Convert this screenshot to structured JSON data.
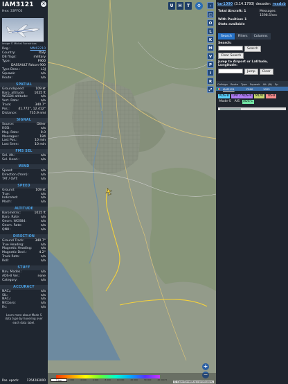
{
  "aircraft": {
    "callsign": "IAM3121",
    "hex": "Hex: 33FFC6",
    "photo_credit": "Image © Michal Furnatrizas"
  },
  "info_rows": [
    {
      "k": "Reg.:",
      "v": "MM62210",
      "link": true
    },
    {
      "k": "Country:",
      "v": "Italy"
    },
    {
      "k": "DB flags:",
      "v": "military"
    },
    {
      "k": "Type:",
      "v": "F900"
    },
    {
      "k": "",
      "v": "DASSAULT Falcon 900"
    },
    {
      "k": "Type Desc.:",
      "v": "L3J"
    },
    {
      "k": "Squawk:",
      "v": "n/a"
    },
    {
      "k": "Route:",
      "v": "n/a"
    }
  ],
  "sections": {
    "spatial": {
      "title": "SPATIAL",
      "rows": [
        {
          "k": "Groundspeed:",
          "v": "109 kt"
        },
        {
          "k": "Baro. altitude:",
          "v": "1025 ft"
        },
        {
          "k": "WGS84 altitude:",
          "v": "n/a"
        },
        {
          "k": "Vert. Rate:",
          "v": "n/a"
        },
        {
          "k": "Track:",
          "v": "340.7°"
        },
        {
          "k": "Pos.:",
          "v": "41.772°, 12.412°"
        },
        {
          "k": "Distance:",
          "v": "735.9 nmi"
        }
      ]
    },
    "signal": {
      "title": "SIGNAL",
      "rows": [
        {
          "k": "Source:",
          "v": "Other"
        },
        {
          "k": "RSSI:",
          "v": "n/a"
        },
        {
          "k": "Msg. Rate:",
          "v": "0.0"
        },
        {
          "k": "Messages:",
          "v": "184"
        },
        {
          "k": "Last Pos.:",
          "v": "10 min"
        },
        {
          "k": "Last Seen:",
          "v": "10 min"
        }
      ]
    },
    "fms": {
      "title": "FMS SEL",
      "rows": [
        {
          "k": "Sel. Alt.:",
          "v": "n/a"
        },
        {
          "k": "Sel. Head.:",
          "v": "n/a"
        }
      ]
    },
    "wind": {
      "title": "WIND",
      "rows": [
        {
          "k": "Speed:",
          "v": "n/a"
        },
        {
          "k": "Direction (from):",
          "v": "n/a"
        },
        {
          "k": "TAT / OAT:",
          "v": "n/a"
        }
      ]
    },
    "speed": {
      "title": "SPEED",
      "rows": [
        {
          "k": "Ground:",
          "v": "109 kt"
        },
        {
          "k": "True:",
          "v": "n/a"
        },
        {
          "k": "Indicated:",
          "v": "n/a"
        },
        {
          "k": "Mach:",
          "v": "n/a"
        }
      ]
    },
    "altitude": {
      "title": "ALTITUDE",
      "rows": [
        {
          "k": "Barometric:",
          "v": "1025 ft"
        },
        {
          "k": "Baro. Rate:",
          "v": "n/a"
        },
        {
          "k": "Geom. WGS84:",
          "v": "n/a"
        },
        {
          "k": "Geom. Rate:",
          "v": "n/a"
        },
        {
          "k": "QNH:",
          "v": "n/a"
        }
      ]
    },
    "direction": {
      "title": "DIRECTION",
      "rows": [
        {
          "k": "Ground Track:",
          "v": "340.7°"
        },
        {
          "k": "True Heading:",
          "v": "n/a"
        },
        {
          "k": "Magnetic Heading:",
          "v": "n/a"
        },
        {
          "k": "Magnetic Decl.:",
          "v": "4.2°"
        },
        {
          "k": "Track Rate:",
          "v": "n/a"
        },
        {
          "k": "Roll:",
          "v": "n/a"
        }
      ]
    },
    "stuff": {
      "title": "STUFF",
      "rows": [
        {
          "k": "Nav. Modes:",
          "v": "n/a"
        },
        {
          "k": "ADS-B Ver.:",
          "v": "none"
        },
        {
          "k": "Category:",
          "v": "n/a"
        }
      ]
    },
    "accuracy": {
      "title": "ACCURACY",
      "rows": [
        {
          "k": "NACₚ:",
          "v": "n/a"
        },
        {
          "k": "SIL:",
          "v": "n/a"
        },
        {
          "k": "NACᵥ:",
          "v": "n/a"
        },
        {
          "k": "NICbaro:",
          "v": "n/a"
        },
        {
          "k": "Rc:",
          "v": "n/a"
        }
      ]
    }
  },
  "note": "Learn more about Mode S data type by hovering over each data label.",
  "footer": {
    "k": "Pos. epoch:",
    "v": "1764283000"
  },
  "map": {
    "buttons": [
      "U",
      "H",
      "T"
    ],
    "side_buttons": [
      "O",
      "L",
      "K",
      "M",
      "V",
      "P",
      "I",
      "R"
    ],
    "zoom_in": "+",
    "zoom_out": "−",
    "scale": "2 km",
    "attribution": "© OpenStreetMap contributors.",
    "legend_ticks": [
      "1 000",
      "2 000",
      "4 000",
      "6 000",
      "8 000",
      "10 000",
      "20 000",
      "30 000",
      "40 000 ft"
    ],
    "track_color": "#f6d23a"
  },
  "right": {
    "link": "tar1090",
    "version": "(3.14.1793)",
    "decoder_label": "decoder:",
    "decoder_link": "readsb",
    "total_label": "Total Aircraft: 1",
    "messages_label": "Messages:",
    "messages_value": "1598.5/sec",
    "position_label": "With Position: 1",
    "stats_label": "Stats available",
    "tabs": [
      "Search",
      "Filters",
      "Columns"
    ],
    "search_label": "Search:",
    "search_button": "Search",
    "clear_button": "Clear Search",
    "jump_label": "Jump to Airport or Latitude, Longitude:",
    "jump_button": "Jump",
    "jump_clear": "Clear",
    "columns": [
      "Callsign",
      "Route",
      "Type",
      "Squawk",
      "Alt. (ft)",
      "Sp"
    ],
    "row": [
      "IAM3121",
      "",
      "F900",
      "",
      "1025",
      ""
    ],
    "chips": [
      {
        "label": "ADS-B",
        "cls": "c1"
      },
      {
        "label": "UAT / ADS-R",
        "cls": "c2"
      },
      {
        "label": "MLAT",
        "cls": "c3"
      },
      {
        "label": "TIS-B",
        "cls": "c4"
      },
      {
        "label": "Mode-S",
        "cls": "c5"
      },
      {
        "label": "AIS",
        "cls": "c6"
      },
      {
        "label": "ADS-C",
        "cls": "c7"
      }
    ]
  }
}
